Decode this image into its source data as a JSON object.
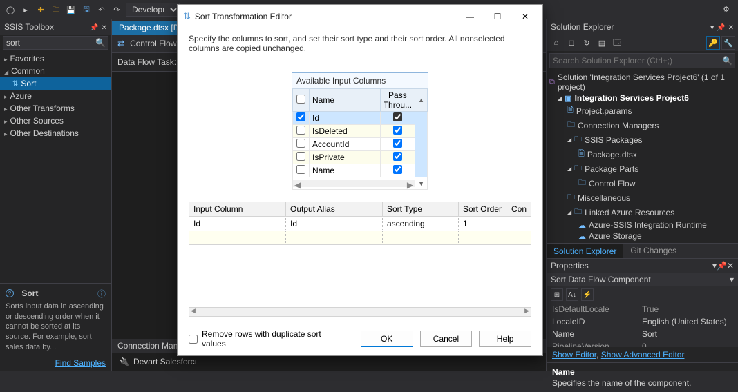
{
  "topbar": {
    "config": "Developı"
  },
  "toolbox": {
    "title": "SSIS Toolbox",
    "search": "sort",
    "groups": {
      "favorites": "Favorites",
      "common": "Common",
      "azure": "Azure",
      "otherTransforms": "Other Transforms",
      "otherSources": "Other Sources",
      "otherDestinations": "Other Destinations"
    },
    "selected": "Sort",
    "hint": {
      "title": "Sort",
      "desc": "Sorts input data in ascending or descending order when it cannot be sorted at its source. For example, sort sales data by..."
    },
    "findSamples": "Find Samples"
  },
  "center": {
    "tab": "Package.dtsx [Desigı",
    "controlFlow": "Control Flow",
    "dataFlowTask": "Data Flow Task:",
    "connTitle": "Connection Manaç",
    "connItem": "Devart Salesforcı"
  },
  "dialog": {
    "title": "Sort Transformation Editor",
    "desc": "Specify the columns to sort, and set their sort type and their sort order. All nonselected columns are copied unchanged.",
    "availTitle": "Available Input Columns",
    "cols": {
      "name": "Name",
      "pass": "Pass Throu..."
    },
    "rows": [
      {
        "name": "Id",
        "sel": true,
        "pass": true
      },
      {
        "name": "IsDeleted",
        "sel": false,
        "pass": true
      },
      {
        "name": "AccountId",
        "sel": false,
        "pass": true
      },
      {
        "name": "IsPrivate",
        "sel": false,
        "pass": true
      },
      {
        "name": "Name",
        "sel": false,
        "pass": true
      }
    ],
    "grid": {
      "headers": {
        "input": "Input Column",
        "alias": "Output Alias",
        "type": "Sort Type",
        "order": "Sort Order",
        "comp": "Con"
      },
      "row": {
        "input": "Id",
        "alias": "Id",
        "type": "ascending",
        "order": "1"
      }
    },
    "removeDup": "Remove rows with duplicate sort values",
    "ok": "OK",
    "cancel": "Cancel",
    "help": "Help"
  },
  "solution": {
    "title": "Solution Explorer",
    "searchPlaceholder": "Search Solution Explorer (Ctrl+;)",
    "root": "Solution 'Integration Services Project6' (1 of 1 project)",
    "project": "Integration Services Project6",
    "nodes": {
      "params": "Project.params",
      "connMgr": "Connection Managers",
      "ssispkgs": "SSIS Packages",
      "pkg": "Package.dtsx",
      "pkgparts": "Package Parts",
      "ctrlflow": "Control Flow",
      "misc": "Miscellaneous",
      "linked": "Linked Azure Resources",
      "azir": "Azure-SSIS Integration Runtime",
      "azstor": "Azure Storage"
    },
    "tabs": {
      "se": "Solution Explorer",
      "gc": "Git Changes"
    }
  },
  "props": {
    "title": "Properties",
    "obj": "Sort Data Flow Component",
    "rows": [
      {
        "k": "IsDefaultLocale",
        "v": "True"
      },
      {
        "k": "LocaleID",
        "v": "English (United States)"
      },
      {
        "k": "Name",
        "v": "Sort"
      },
      {
        "k": "PipelineVersion",
        "v": "0"
      }
    ],
    "links": {
      "show": "Show Editor",
      "adv": "Show Advanced Editor"
    },
    "help": {
      "name": "Name",
      "desc": "Specifies the name of the component."
    }
  }
}
